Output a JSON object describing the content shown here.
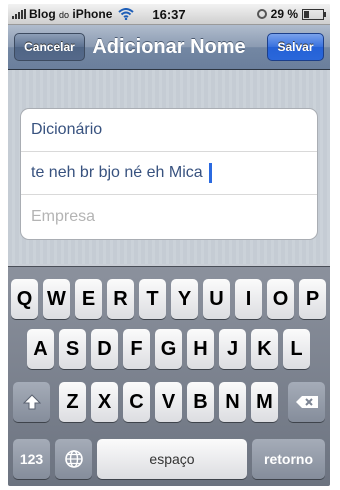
{
  "status_bar": {
    "carrier": "Blog",
    "carrier_small": "do",
    "carrier_suffix": "iPhone",
    "time": "16:37",
    "battery_percent": "29 %",
    "battery_level": 0.29
  },
  "nav": {
    "title": "Adicionar Nome",
    "cancel_label": "Cancelar",
    "save_label": "Salvar"
  },
  "form": {
    "field1_value": "Dicionário",
    "field2_value": "te neh br bjo né eh Mica",
    "field3_placeholder": "Empresa"
  },
  "keyboard": {
    "row1": [
      "Q",
      "W",
      "E",
      "R",
      "T",
      "Y",
      "U",
      "I",
      "O",
      "P"
    ],
    "row2": [
      "A",
      "S",
      "D",
      "F",
      "G",
      "H",
      "J",
      "K",
      "L"
    ],
    "row3": [
      "Z",
      "X",
      "C",
      "V",
      "B",
      "N",
      "M"
    ],
    "numbers_label": "123",
    "space_label": "espaço",
    "return_label": "retorno"
  },
  "colors": {
    "nav_bar": "#7387a3",
    "save_button": "#2a67da",
    "cursor": "#2b6ae0"
  }
}
